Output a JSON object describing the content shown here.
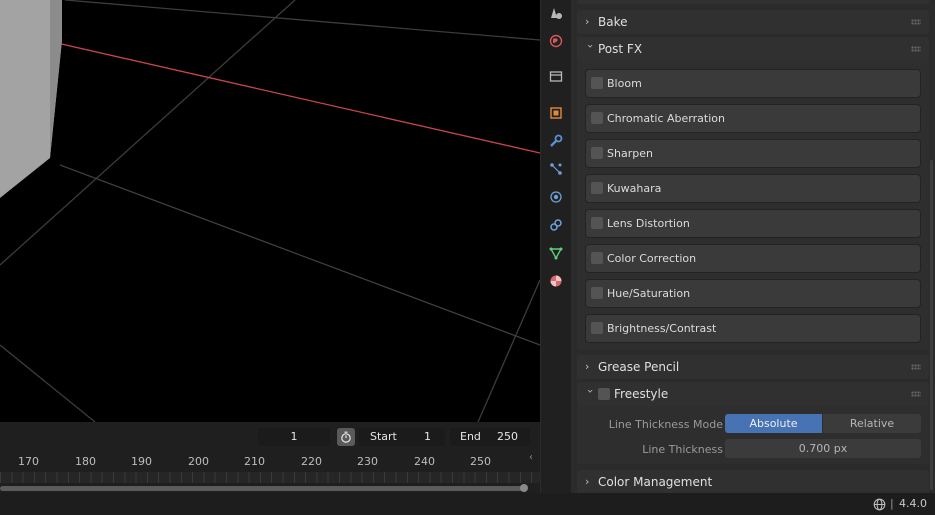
{
  "timeline": {
    "current_frame": "1",
    "start_label": "Start",
    "start_value": "1",
    "end_label": "End",
    "end_value": "250",
    "ruler_ticks": [
      "170",
      "180",
      "190",
      "200",
      "210",
      "220",
      "230",
      "240",
      "250"
    ]
  },
  "tabs": [
    {
      "name": "tool-icon",
      "color": "#b8b8b8"
    },
    {
      "name": "world-icon",
      "color": "#d05a5a"
    },
    {
      "name": "collection-icon",
      "color": "#b8b8b8"
    },
    {
      "name": "object-icon",
      "color": "#e08a3c"
    },
    {
      "name": "modifier-icon",
      "color": "#5a8fd6"
    },
    {
      "name": "particles-icon",
      "color": "#6fa0d8"
    },
    {
      "name": "physics-icon",
      "color": "#6fa0d8"
    },
    {
      "name": "constraints-icon",
      "color": "#6fa0d8"
    },
    {
      "name": "data-icon",
      "color": "#5fd07a"
    },
    {
      "name": "material-icon",
      "color": "#d56a6a"
    }
  ],
  "props": {
    "bake": "Bake",
    "post_fx": "Post FX",
    "post_fx_items": [
      "Bloom",
      "Chromatic Aberration",
      "Sharpen",
      "Kuwahara",
      "Lens Distortion",
      "Color Correction",
      "Hue/Saturation",
      "Brightness/Contrast"
    ],
    "grease_pencil": "Grease Pencil",
    "freestyle": "Freestyle",
    "line_thickness_mode_label": "Line Thickness Mode",
    "mode_absolute": "Absolute",
    "mode_relative": "Relative",
    "line_thickness_label": "Line Thickness",
    "line_thickness_value": "0.700 px",
    "color_management": "Color Management"
  },
  "status": {
    "version": "4.4.0"
  },
  "colors": {
    "accent": "#4772b3",
    "x_axis": "#c8454f",
    "panel": "#2b2b2b",
    "sub_panel": "#3a3a3a"
  }
}
